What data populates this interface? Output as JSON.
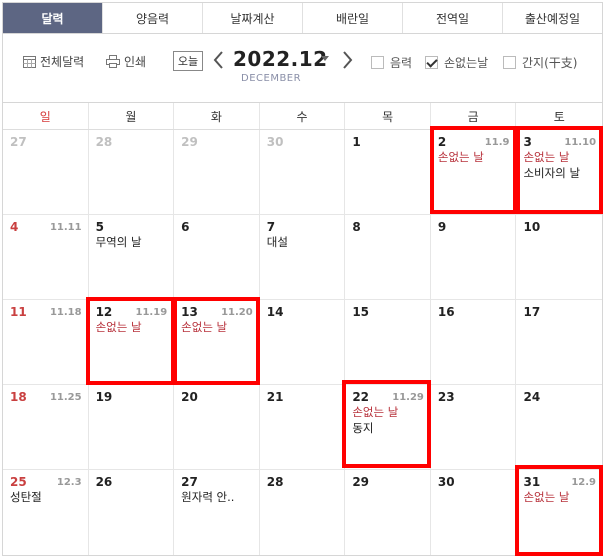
{
  "tabs": [
    "달력",
    "양음력",
    "날짜계산",
    "배란일",
    "전역일",
    "출산예정일"
  ],
  "toolbar": {
    "full_calendar": "전체달력",
    "print": "인쇄",
    "today": "오늘",
    "title": "2022.12",
    "subtitle": "DECEMBER",
    "lunar_label": "음력",
    "nohand_label": "손없는날",
    "ganji_label": "간지(干支)"
  },
  "weekdays": [
    "일",
    "월",
    "화",
    "수",
    "목",
    "금",
    "토"
  ],
  "weeks": [
    [
      {
        "num": "27",
        "other": true
      },
      {
        "num": "28",
        "other": true
      },
      {
        "num": "29",
        "other": true
      },
      {
        "num": "30",
        "other": true
      },
      {
        "num": "1"
      },
      {
        "num": "2",
        "lunar": "11.9",
        "events": [
          {
            "text": "손없는 날",
            "red": true
          }
        ]
      },
      {
        "num": "3",
        "lunar": "11.10",
        "events": [
          {
            "text": "손없는 날",
            "red": true
          },
          {
            "text": "소비자의 날"
          }
        ]
      }
    ],
    [
      {
        "num": "4",
        "lunar": "11.11",
        "sun": true
      },
      {
        "num": "5",
        "events": [
          {
            "text": "무역의 날"
          }
        ]
      },
      {
        "num": "6"
      },
      {
        "num": "7",
        "events": [
          {
            "text": "대설"
          }
        ]
      },
      {
        "num": "8"
      },
      {
        "num": "9"
      },
      {
        "num": "10"
      }
    ],
    [
      {
        "num": "11",
        "lunar": "11.18",
        "sun": true
      },
      {
        "num": "12",
        "lunar": "11.19",
        "events": [
          {
            "text": "손없는 날",
            "red": true
          }
        ]
      },
      {
        "num": "13",
        "lunar": "11.20",
        "events": [
          {
            "text": "손없는 날",
            "red": true
          }
        ]
      },
      {
        "num": "14"
      },
      {
        "num": "15"
      },
      {
        "num": "16"
      },
      {
        "num": "17"
      }
    ],
    [
      {
        "num": "18",
        "lunar": "11.25",
        "sun": true
      },
      {
        "num": "19"
      },
      {
        "num": "20"
      },
      {
        "num": "21"
      },
      {
        "num": "22",
        "lunar": "11.29",
        "events": [
          {
            "text": "손없는 날",
            "red": true
          },
          {
            "text": "동지"
          }
        ]
      },
      {
        "num": "23"
      },
      {
        "num": "24"
      }
    ],
    [
      {
        "num": "25",
        "lunar": "12.3",
        "sun": true,
        "events": [
          {
            "text": "성탄절"
          }
        ]
      },
      {
        "num": "26"
      },
      {
        "num": "27",
        "events": [
          {
            "text": "원자력 안.."
          }
        ]
      },
      {
        "num": "28"
      },
      {
        "num": "29"
      },
      {
        "num": "30"
      },
      {
        "num": "31",
        "lunar": "12.9",
        "events": [
          {
            "text": "손없는 날",
            "red": true
          }
        ]
      }
    ]
  ],
  "highlight_color": "#ff0000"
}
